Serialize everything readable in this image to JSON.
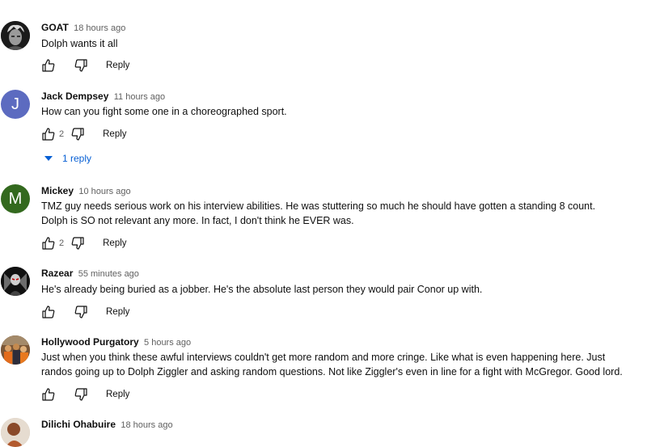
{
  "comments": [
    {
      "author": "GOAT",
      "time": "18 hours ago",
      "lines": [
        "Dolph wants it all"
      ],
      "likes": "",
      "reply_label": "Reply",
      "avatar": {
        "type": "image",
        "icon": "photo-avatar-grayscale-face"
      }
    },
    {
      "author": "Jack Dempsey",
      "time": "11 hours ago",
      "lines": [
        "How can you fight some one in a choreographed sport."
      ],
      "likes": "2",
      "reply_label": "Reply",
      "avatar": {
        "type": "letter",
        "letter": "J",
        "color": "#5c6bc0"
      },
      "replies_label": "1 reply"
    },
    {
      "author": "Mickey",
      "time": "10 hours ago",
      "lines": [
        "TMZ guy needs serious work on his interview abilities. He was stuttering so much he should have gotten a standing 8 count.",
        "Dolph is SO not relevant any more. In fact, I don't think he EVER was."
      ],
      "likes": "2",
      "reply_label": "Reply",
      "avatar": {
        "type": "letter",
        "letter": "M",
        "color": "#33691e"
      }
    },
    {
      "author": "Razear",
      "time": "55 minutes ago",
      "lines": [
        "He's already being buried as a jobber. He's the absolute last person they would pair Conor up with."
      ],
      "likes": "",
      "reply_label": "Reply",
      "avatar": {
        "type": "image",
        "icon": "photo-avatar-dark-figure"
      }
    },
    {
      "author": "Hollywood Purgatory",
      "time": "5 hours ago",
      "lines": [
        "Just when you think these awful interviews couldn't get more random and more cringe. Like what is even happening here. Just",
        "randos going up to Dolph Ziggler and asking random questions. Not like Ziggler's even in line for a fight with McGregor. Good lord."
      ],
      "likes": "",
      "reply_label": "Reply",
      "avatar": {
        "type": "image",
        "icon": "photo-avatar-orange-crowd"
      }
    },
    {
      "author": "Dilichi Ohabuire",
      "time": "18 hours ago",
      "lines": [],
      "likes": "",
      "reply_label": "",
      "avatar": {
        "type": "image",
        "icon": "photo-avatar-person"
      }
    }
  ],
  "colors": {
    "link": "#065fd4",
    "secondary": "#606060",
    "text": "#0f0f0f"
  }
}
